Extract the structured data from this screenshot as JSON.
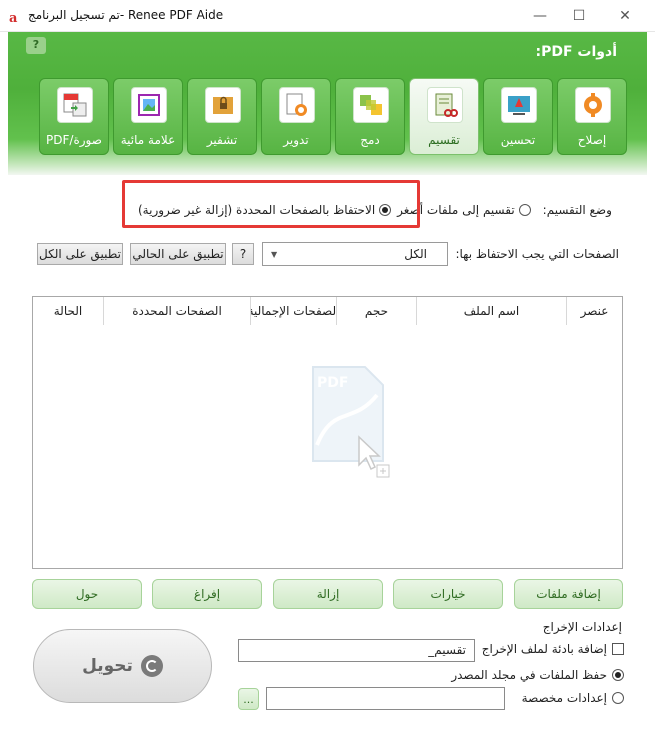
{
  "window": {
    "title": "تم تسجيل البرنامج- Renee PDF Aide",
    "minimize": "—",
    "maximize": "☐",
    "close": "✕"
  },
  "header": {
    "tools_label": "أدوات PDF:",
    "help": "?"
  },
  "tools": [
    {
      "label": "إصلاح",
      "icon": "repair-icon"
    },
    {
      "label": "تحسين",
      "icon": "optimize-icon"
    },
    {
      "label": "تقسيم",
      "icon": "split-icon",
      "active": true
    },
    {
      "label": "دمج",
      "icon": "merge-icon"
    },
    {
      "label": "تدوير",
      "icon": "rotate-icon"
    },
    {
      "label": "تشفير",
      "icon": "encrypt-icon"
    },
    {
      "label": "علامة مائية",
      "icon": "watermark-icon"
    },
    {
      "label": "PDF/صورة",
      "icon": "pdf-image-icon"
    }
  ],
  "split_mode": {
    "label": "وضع التقسيم:",
    "option_small_files": "تقسيم إلى ملفات أصغر",
    "option_keep_pages": "الاحتفاظ بالصفحات المحددة (إزالة غير ضرورية)",
    "selected": "keep_pages"
  },
  "pages": {
    "label": "الصفحات التي يجب الاحتفاظ بها:",
    "value": "الكل",
    "help": "?",
    "apply_current": "تطبيق على الحالي",
    "apply_all": "تطبيق على الكل"
  },
  "table": {
    "columns": [
      "عنصر",
      "اسم الملف",
      "حجم",
      "الصفحات الإجمالية",
      "الصفحات المحددة",
      "الحالة"
    ]
  },
  "actions": {
    "add_files": "إضافة ملفات",
    "options": "خيارات",
    "remove": "إزالة",
    "clear": "إفراغ",
    "about": "حول"
  },
  "output": {
    "title": "إعدادات الإخراج",
    "suffix_label": "إضافة بادئة لملف الإخراج",
    "suffix_value": "تقسيم_",
    "save_source_label": "حفظ الملفات في مجلد المصدر",
    "custom_label": "إعدادات مخصصة",
    "browse": "...",
    "selected": "save_source"
  },
  "convert": {
    "label": "تحويل"
  },
  "colors": {
    "accent_green": "#4fb03b",
    "highlight_red": "#e53935"
  }
}
